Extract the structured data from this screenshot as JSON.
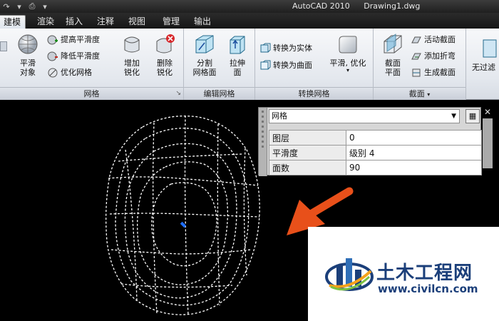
{
  "window": {
    "app_title": "AutoCAD 2010",
    "file_title": "Drawing1.dwg"
  },
  "tabs": [
    {
      "label": "建模",
      "active": true
    },
    {
      "label": "渲染",
      "active": false
    },
    {
      "label": "插入",
      "active": false
    },
    {
      "label": "注释",
      "active": false
    },
    {
      "label": "视图",
      "active": false
    },
    {
      "label": "管理",
      "active": false
    },
    {
      "label": "输出",
      "active": false
    }
  ],
  "ribbon": {
    "mesh_panel": {
      "title": "网格",
      "smooth_object_label": "平滑\n对象",
      "increase_smooth": "提高平滑度",
      "decrease_smooth": "降低平滑度",
      "optimize_mesh": "优化网格",
      "add_crease": "增加\n锐化",
      "remove_crease": "删除\n锐化"
    },
    "edit_mesh_panel": {
      "title": "编辑网格",
      "split_face": "分割\n网格面",
      "extrude_face": "拉伸\n面"
    },
    "convert_panel": {
      "title": "转换网格",
      "to_solid": "转换为实体",
      "to_surface": "转换为曲面",
      "smooth_optimize": "平滑, 优化"
    },
    "section_panel": {
      "title": "截面",
      "section_plane": "截面\n平面",
      "live_section": "活动截面",
      "add_jog": "添加折弯",
      "generate_section": "生成截面"
    },
    "next_panel_label": "无过滤"
  },
  "properties": {
    "object_type": "网格",
    "rows": [
      {
        "key": "图层",
        "value": "0"
      },
      {
        "key": "平滑度",
        "value": "级别 4"
      },
      {
        "key": "面数",
        "value": "90"
      }
    ]
  },
  "watermark": {
    "title": "土木工程网",
    "url": "www.civilcn.com"
  },
  "colors": {
    "arrow": "#e8501a",
    "mesh_lines": "#ffffff",
    "brand": "#1b3f7a"
  }
}
